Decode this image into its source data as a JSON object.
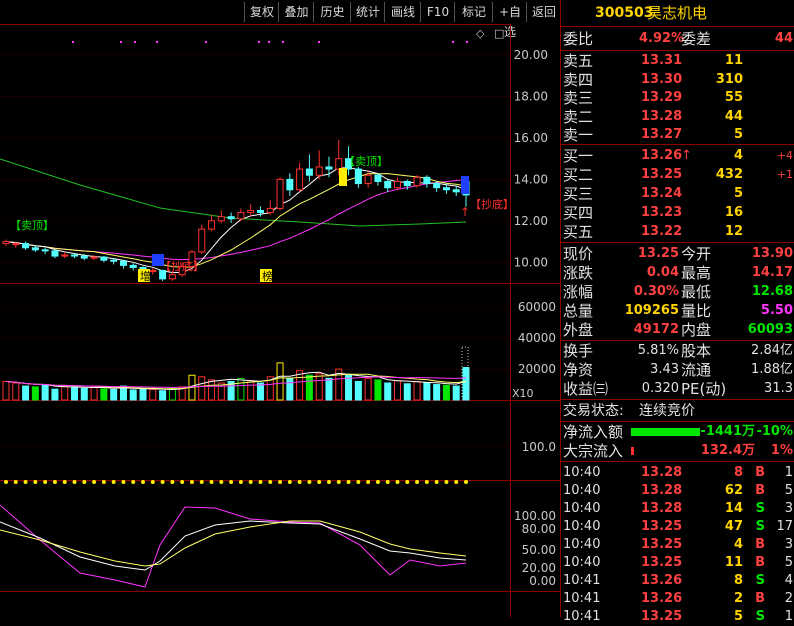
{
  "toolbar": {
    "buttons": [
      "复权",
      "叠加",
      "历史",
      "统计",
      "画线",
      "F10",
      "标记",
      "+自选",
      "返回"
    ]
  },
  "stock": {
    "code": "300503",
    "name": "昊志机电"
  },
  "order_book": {
    "wei_bi_label": "委比",
    "wei_bi_value": "4.92%",
    "wei_cha_label": "委差",
    "wei_cha_value": "44",
    "asks": [
      {
        "label": "卖五",
        "price": "13.31",
        "vol": "11"
      },
      {
        "label": "卖四",
        "price": "13.30",
        "vol": "310"
      },
      {
        "label": "卖三",
        "price": "13.29",
        "vol": "55"
      },
      {
        "label": "卖二",
        "price": "13.28",
        "vol": "44"
      },
      {
        "label": "卖一",
        "price": "13.27",
        "vol": "5"
      }
    ],
    "bids": [
      {
        "label": "买一",
        "price": "13.26",
        "arrow": "↑",
        "vol": "4",
        "chg": "+4"
      },
      {
        "label": "买二",
        "price": "13.25",
        "arrow": "",
        "vol": "432",
        "chg": "+1"
      },
      {
        "label": "买三",
        "price": "13.24",
        "arrow": "",
        "vol": "5",
        "chg": ""
      },
      {
        "label": "买四",
        "price": "13.23",
        "arrow": "",
        "vol": "16",
        "chg": ""
      },
      {
        "label": "买五",
        "price": "13.22",
        "arrow": "",
        "vol": "12",
        "chg": ""
      }
    ]
  },
  "quote": [
    {
      "l1": "现价",
      "v1": "13.25",
      "c1": "red",
      "l2": "今开",
      "v2": "13.90",
      "c2": "red"
    },
    {
      "l1": "涨跌",
      "v1": "0.04",
      "c1": "red",
      "l2": "最高",
      "v2": "14.17",
      "c2": "red"
    },
    {
      "l1": "涨幅",
      "v1": "0.30%",
      "c1": "red",
      "l2": "最低",
      "v2": "12.68",
      "c2": "green"
    },
    {
      "l1": "总量",
      "v1": "109265",
      "c1": "yellow",
      "l2": "量比",
      "v2": "5.50",
      "c2": "magenta"
    },
    {
      "l1": "外盘",
      "v1": "49172",
      "c1": "red",
      "l2": "内盘",
      "v2": "60093",
      "c2": "green"
    }
  ],
  "fundamentals": [
    {
      "l1": "换手",
      "v1": "5.81%",
      "l2": "股本",
      "v2": "2.84亿"
    },
    {
      "l1": "净资",
      "v1": "3.43",
      "l2": "流通",
      "v2": "1.88亿"
    },
    {
      "l1": "收益㈢",
      "v1": "0.320",
      "l2": "PE(动)",
      "v2": "31.3"
    }
  ],
  "trade_status": {
    "label": "交易状态:",
    "value": "连续竞价"
  },
  "flows": [
    {
      "label": "净流入额",
      "value": "-1441万",
      "pct": "-10%",
      "bar_color": "#00e600",
      "bar_fraction": 0.75,
      "vcolor": "green"
    },
    {
      "label": "大宗流入",
      "value": "132.4万",
      "pct": "1%",
      "bar_color": "#ff3030",
      "bar_fraction": 0.03,
      "vcolor": "red"
    }
  ],
  "ticks": [
    {
      "time": "10:40",
      "price": "13.28",
      "pc": "red",
      "vol": "8",
      "vc": "red",
      "bs": "B",
      "bsc": "red",
      "n": "1"
    },
    {
      "time": "10:40",
      "price": "13.28",
      "pc": "red",
      "vol": "62",
      "vc": "yellow",
      "bs": "B",
      "bsc": "red",
      "n": "5"
    },
    {
      "time": "10:40",
      "price": "13.28",
      "pc": "red",
      "vol": "14",
      "vc": "yellow",
      "bs": "S",
      "bsc": "green",
      "n": "3"
    },
    {
      "time": "10:40",
      "price": "13.25",
      "pc": "red",
      "vol": "47",
      "vc": "yellow",
      "bs": "S",
      "bsc": "green",
      "n": "17"
    },
    {
      "time": "10:40",
      "price": "13.25",
      "pc": "red",
      "vol": "4",
      "vc": "yellow",
      "bs": "B",
      "bsc": "red",
      "n": "3"
    },
    {
      "time": "10:40",
      "price": "13.25",
      "pc": "red",
      "vol": "11",
      "vc": "yellow",
      "bs": "B",
      "bsc": "red",
      "n": "5"
    },
    {
      "time": "10:41",
      "price": "13.26",
      "pc": "red",
      "vol": "8",
      "vc": "yellow",
      "bs": "S",
      "bsc": "green",
      "n": "4"
    },
    {
      "time": "10:41",
      "price": "13.26",
      "pc": "red",
      "vol": "2",
      "vc": "yellow",
      "bs": "B",
      "bsc": "red",
      "n": "2"
    },
    {
      "time": "10:41",
      "price": "13.25",
      "pc": "red",
      "vol": "5",
      "vc": "yellow",
      "bs": "S",
      "bsc": "green",
      "n": "1"
    }
  ],
  "chart_data": [
    {
      "type": "candlestick",
      "y_ticks": [
        "20.00",
        "18.00",
        "16.00",
        "14.00",
        "12.00",
        "10.00"
      ],
      "ylim": [
        9.0,
        21.5
      ],
      "annotations": [
        "【卖顶】",
        "【卖顶】",
        "【抄底】",
        "【抄底】",
        "增",
        "榜"
      ],
      "candles": [
        [
          10.9,
          11.0,
          10.8,
          11.1
        ],
        [
          10.85,
          10.9,
          10.7,
          11.0
        ],
        [
          10.9,
          10.7,
          10.6,
          11.0
        ],
        [
          10.7,
          10.6,
          10.5,
          10.8
        ],
        [
          10.6,
          10.55,
          10.4,
          10.7
        ],
        [
          10.55,
          10.3,
          10.2,
          10.6
        ],
        [
          10.3,
          10.35,
          10.2,
          10.5
        ],
        [
          10.35,
          10.3,
          10.2,
          10.45
        ],
        [
          10.3,
          10.2,
          10.1,
          10.4
        ],
        [
          10.2,
          10.25,
          10.1,
          10.35
        ],
        [
          10.25,
          10.1,
          10.0,
          10.3
        ],
        [
          10.1,
          10.05,
          9.9,
          10.2
        ],
        [
          10.05,
          9.85,
          9.7,
          10.1
        ],
        [
          9.85,
          9.75,
          9.6,
          9.95
        ],
        [
          9.75,
          9.55,
          9.4,
          9.8
        ],
        [
          9.55,
          9.6,
          9.4,
          9.75
        ],
        [
          9.6,
          9.2,
          9.1,
          9.65
        ],
        [
          9.2,
          9.4,
          9.1,
          9.6
        ],
        [
          9.4,
          9.8,
          9.3,
          10.0
        ],
        [
          9.8,
          10.5,
          9.7,
          10.6
        ],
        [
          10.5,
          11.6,
          10.4,
          11.8
        ],
        [
          11.6,
          12.0,
          11.5,
          12.3
        ],
        [
          12.0,
          12.2,
          11.9,
          12.5
        ],
        [
          12.2,
          12.1,
          11.9,
          12.4
        ],
        [
          12.1,
          12.4,
          12.0,
          12.6
        ],
        [
          12.4,
          12.5,
          12.2,
          12.8
        ],
        [
          12.5,
          12.4,
          12.2,
          12.7
        ],
        [
          12.4,
          12.6,
          12.3,
          13.0
        ],
        [
          12.6,
          14.0,
          12.5,
          14.1
        ],
        [
          14.0,
          13.5,
          13.2,
          14.3
        ],
        [
          13.5,
          14.5,
          13.4,
          14.8
        ],
        [
          14.5,
          14.2,
          13.9,
          15.2
        ],
        [
          14.2,
          14.6,
          14.0,
          15.4
        ],
        [
          14.6,
          14.5,
          14.1,
          15.1
        ],
        [
          14.5,
          15.0,
          14.2,
          15.9
        ],
        [
          15.0,
          14.5,
          14.2,
          15.6
        ],
        [
          14.5,
          13.8,
          13.6,
          14.6
        ],
        [
          13.8,
          14.2,
          13.6,
          14.4
        ],
        [
          14.2,
          13.9,
          13.7,
          14.3
        ],
        [
          13.9,
          13.6,
          13.4,
          14.0
        ],
        [
          13.6,
          13.9,
          13.5,
          14.1
        ],
        [
          13.9,
          13.7,
          13.5,
          14.0
        ],
        [
          13.7,
          14.1,
          13.6,
          14.2
        ],
        [
          14.1,
          13.8,
          13.6,
          14.2
        ],
        [
          13.8,
          13.6,
          13.4,
          13.9
        ],
        [
          13.6,
          13.5,
          13.3,
          13.8
        ],
        [
          13.5,
          13.4,
          13.2,
          13.7
        ],
        [
          13.9,
          13.25,
          12.68,
          14.17
        ]
      ]
    },
    {
      "type": "bar",
      "title": "volume",
      "y_ticks": [
        "60000",
        "40000",
        "20000"
      ],
      "scale_label": "X10",
      "ylim": [
        0,
        75000
      ],
      "values": [
        12000,
        11000,
        9000,
        8500,
        9500,
        7000,
        9000,
        8000,
        7500,
        8800,
        7200,
        6800,
        9000,
        6500,
        7000,
        6800,
        6000,
        7500,
        8500,
        16000,
        15000,
        13000,
        11000,
        12000,
        14000,
        12500,
        11000,
        15000,
        24000,
        14000,
        19000,
        16000,
        17000,
        14000,
        20000,
        16000,
        12000,
        14000,
        13000,
        11000,
        12500,
        10500,
        12000,
        11000,
        10000,
        9500,
        9000,
        21000
      ]
    },
    {
      "type": "line",
      "y_ticks": [
        "100.0"
      ]
    },
    {
      "type": "line",
      "y_ticks": [
        "100.00",
        "80.00",
        "50.00",
        "20.00",
        "0.00"
      ]
    }
  ]
}
